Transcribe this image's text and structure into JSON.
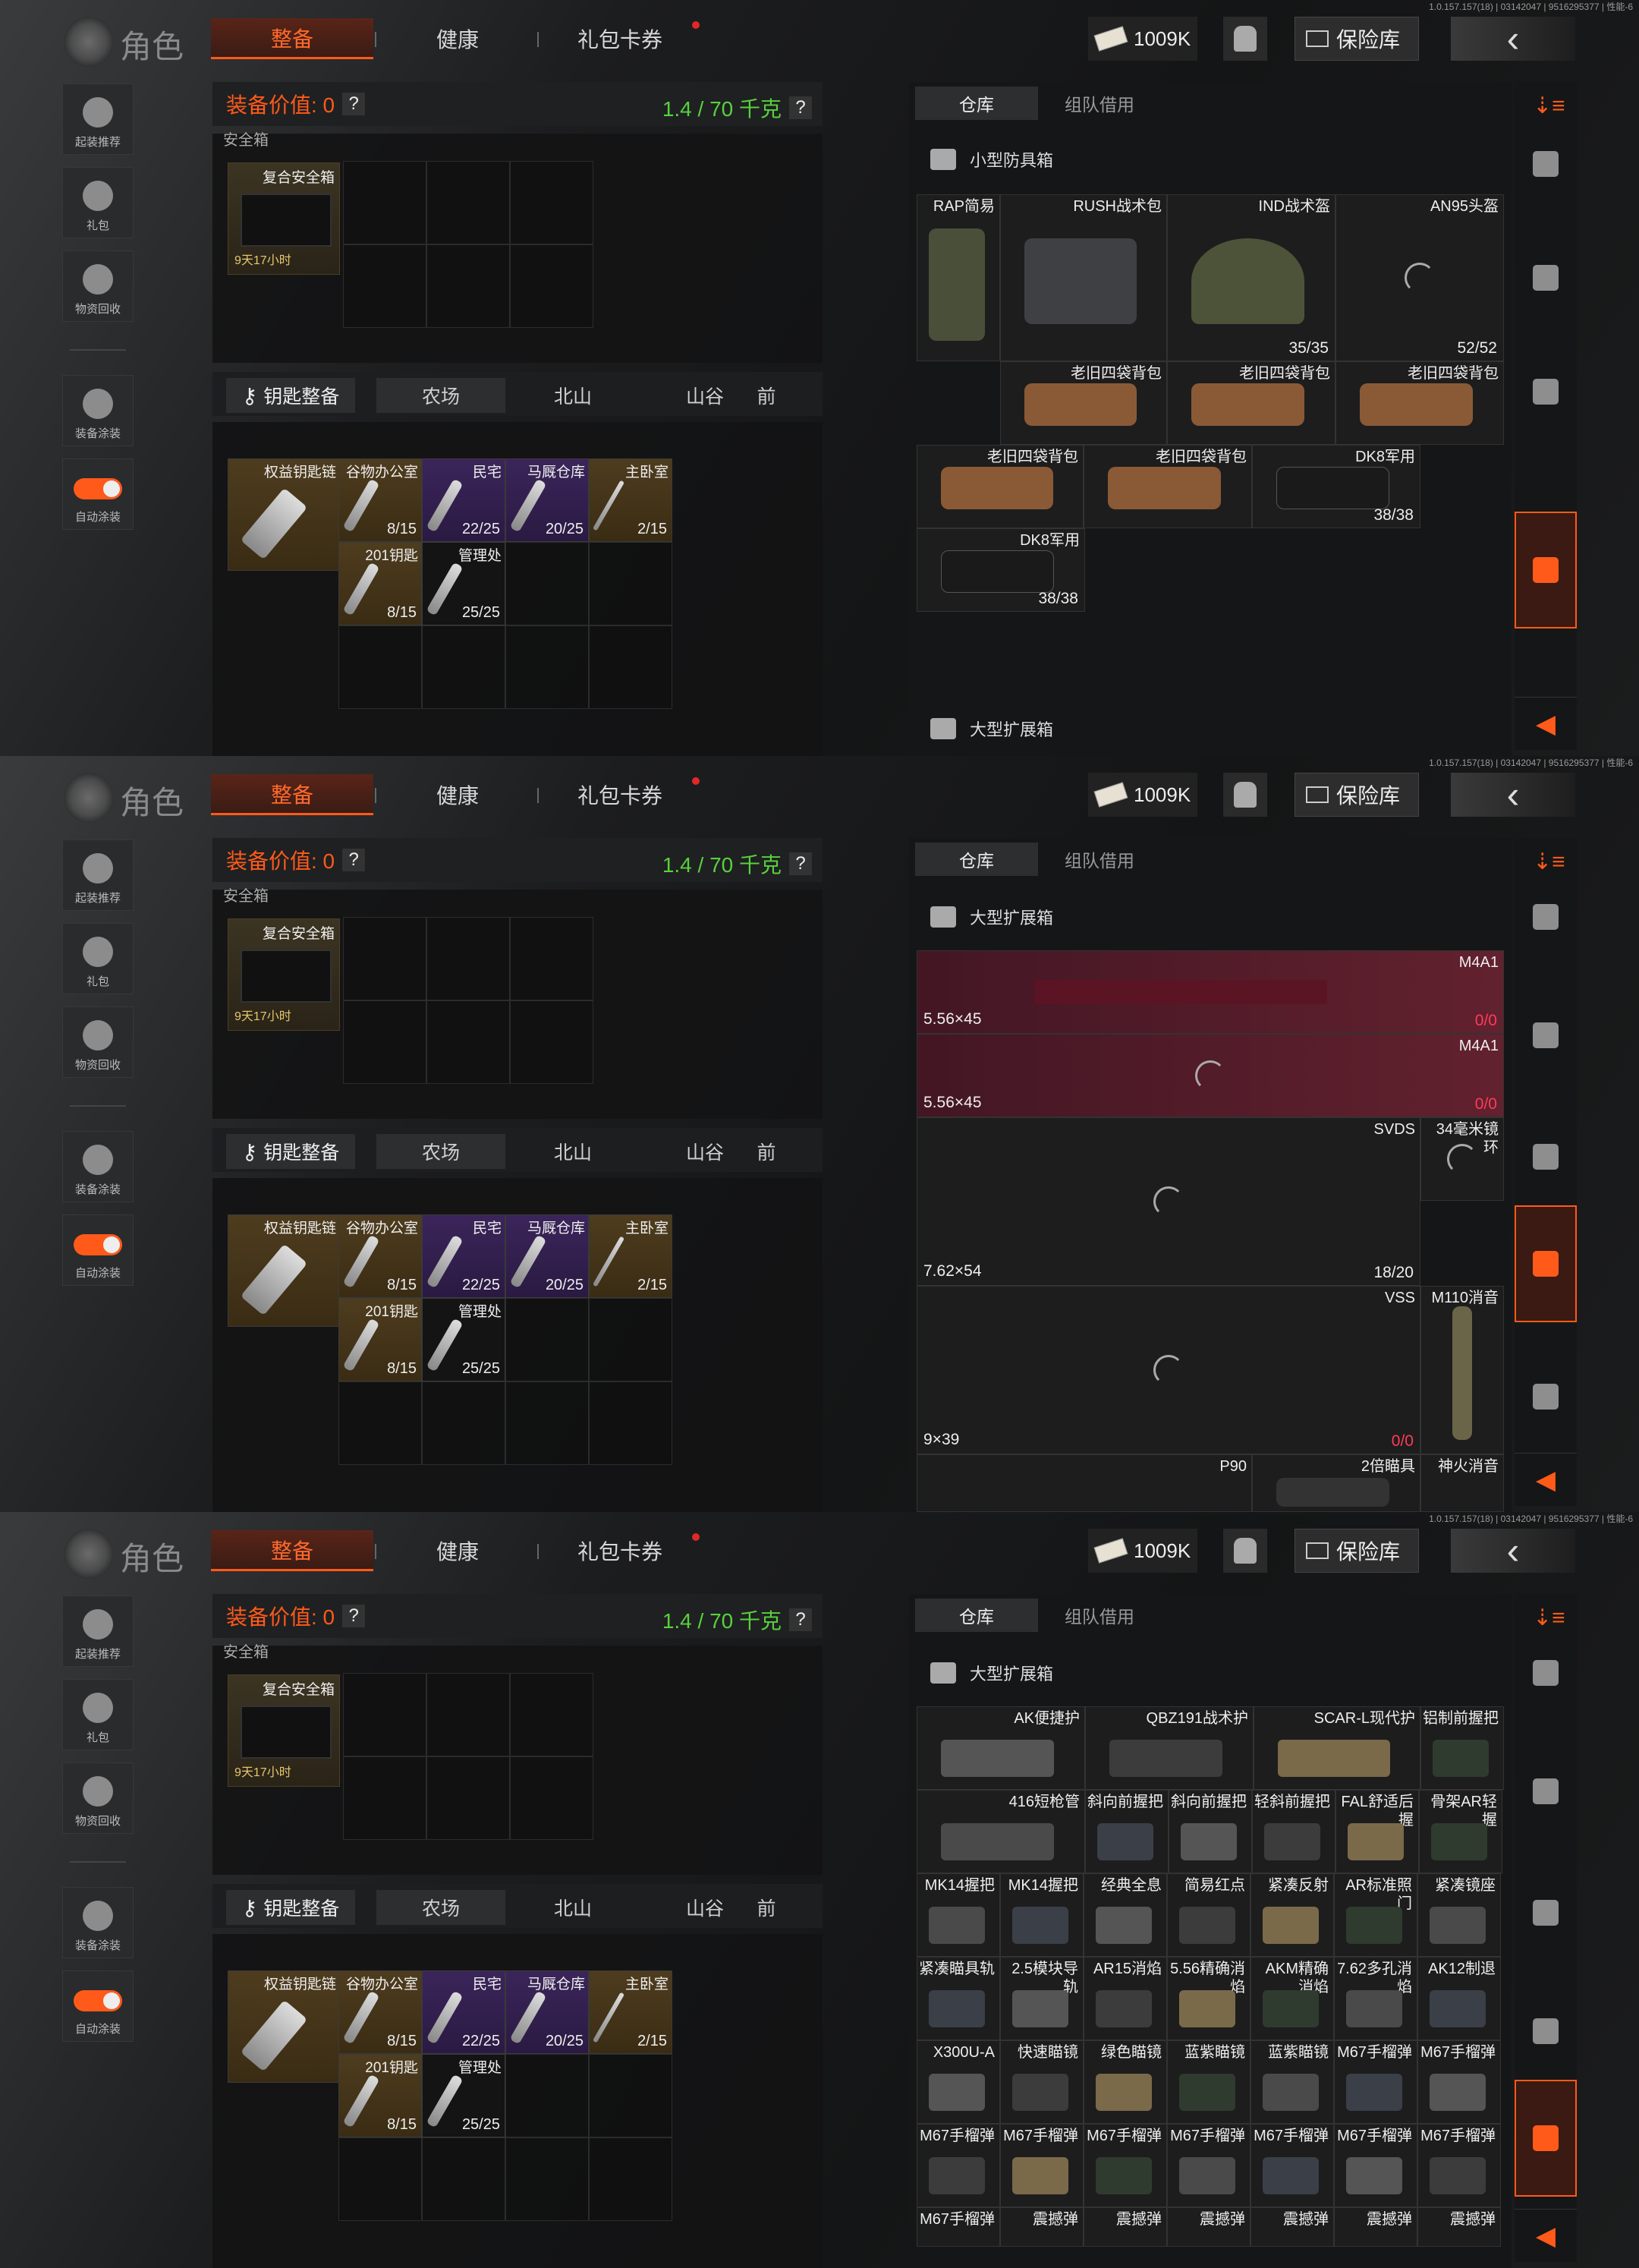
{
  "version": "1.0.157.157(18) | 03142047 | 9516295377 | 性能-6",
  "header": {
    "title": "角色",
    "tabs": [
      "整备",
      "健康",
      "礼包卡券"
    ],
    "money": "1009K",
    "vault": "保险库"
  },
  "sidebar": {
    "items": [
      "起装推荐",
      "礼包",
      "物资回收",
      "装备涂装",
      "自动涂装"
    ]
  },
  "equip": {
    "value_label": "装备价值: 0",
    "weight": "1.4 / 70 千克",
    "help": "?"
  },
  "safebox": {
    "section": "安全箱",
    "name": "复合安全箱",
    "time": "9天17小时"
  },
  "keys": {
    "button": "钥匙整备",
    "tabs": [
      "农场",
      "北山",
      "山谷",
      "前"
    ],
    "chain": "权益钥匙链",
    "items": [
      {
        "name": "谷物办公室",
        "count": "8/15",
        "color": "#4e3c1e"
      },
      {
        "name": "民宅",
        "count": "22/25",
        "color": "#3b255a"
      },
      {
        "name": "马厩仓库",
        "count": "20/25",
        "color": "#3b255a"
      },
      {
        "name": "主卧室",
        "count": "2/15",
        "color": "#4e3c1e"
      },
      {
        "name": "201钥匙",
        "count": "8/15",
        "color": "#4e3c1e"
      },
      {
        "name": "管理处",
        "count": "25/25",
        "color": "#1e1e1f"
      }
    ]
  },
  "warehouse": {
    "tabs": [
      "仓库",
      "组队借用"
    ],
    "section_small": "小型防具箱",
    "section_large": "大型扩展箱",
    "panel1": [
      {
        "name": "RAP简易"
      },
      {
        "name": "RUSH战术包"
      },
      {
        "name": "IND战术盔",
        "count": "35/35"
      },
      {
        "name": "AN95头盔",
        "count": "52/52"
      },
      {
        "name": "老旧四袋背包"
      },
      {
        "name": "老旧四袋背包"
      },
      {
        "name": "老旧四袋背包"
      },
      {
        "name": "老旧四袋背包"
      },
      {
        "name": "老旧四袋背包"
      },
      {
        "name": "DK8军用",
        "count": "38/38"
      },
      {
        "name": "DK8军用",
        "count": "38/38"
      }
    ],
    "panel2": [
      {
        "name": "M4A1",
        "caliber": "5.56×45",
        "count": "0/0"
      },
      {
        "name": "M4A1",
        "caliber": "5.56×45",
        "count": "0/0"
      },
      {
        "name": "SVDS",
        "caliber": "7.62×54",
        "count": "18/20"
      },
      {
        "name": "34毫米镜环"
      },
      {
        "name": "VSS",
        "caliber": "9×39",
        "count": "0/0"
      },
      {
        "name": "M110消音"
      },
      {
        "name": "P90"
      },
      {
        "name": "2倍瞄具"
      },
      {
        "name": "神火消音"
      }
    ],
    "panel3": [
      "AK便捷护",
      "QBZ191战术护",
      "SCAR-L现代护",
      "铝制前握把",
      "416短枪管",
      "斜向前握把",
      "斜向前握把",
      "轻斜前握把",
      "FAL舒适后握",
      "骨架AR轻握",
      "MK14握把",
      "MK14握把",
      "经典全息",
      "简易红点",
      "紧凑反射",
      "AR标准照门",
      "紧凑镜座",
      "紧凑瞄具轨",
      "2.5模块导轨",
      "AR15消焰",
      "5.56精确消焰",
      "AKM精确消焰",
      "7.62多孔消焰",
      "AK12制退",
      "X300U-A",
      "快速瞄镜",
      "绿色瞄镜",
      "蓝紫瞄镜",
      "蓝紫瞄镜",
      "M67手榴弹",
      "M67手榴弹",
      "M67手榴弹",
      "M67手榴弹",
      "M67手榴弹",
      "M67手榴弹",
      "M67手榴弹",
      "M67手榴弹",
      "M67手榴弹",
      "M67手榴弹",
      "震撼弹",
      "震撼弹",
      "震撼弹",
      "震撼弹",
      "震撼弹",
      "震撼弹"
    ]
  },
  "colors": {
    "accent": "#ff5a1a",
    "weight": "#57d23d",
    "purple": "#3b255a",
    "gold": "#4e3c1e"
  }
}
